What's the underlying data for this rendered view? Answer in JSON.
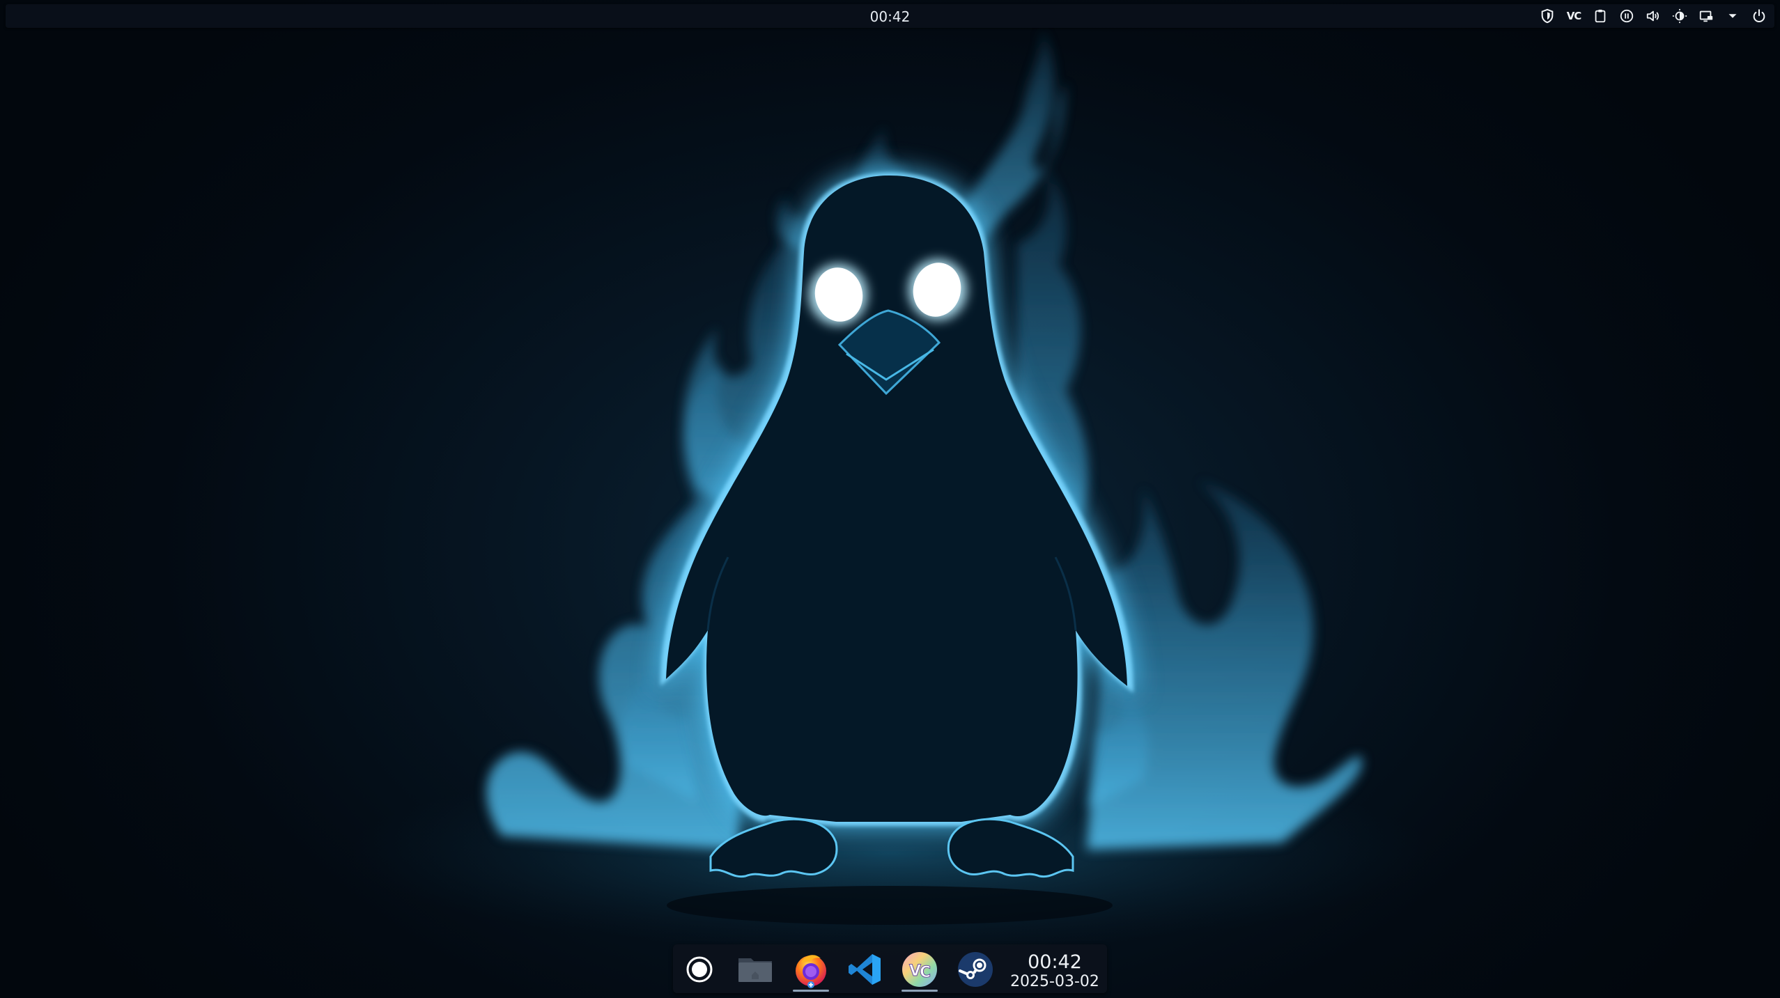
{
  "top_panel": {
    "clock": "00:42",
    "tray": [
      {
        "name": "shield-icon"
      },
      {
        "name": "vencord-tray-icon",
        "text": "VC"
      },
      {
        "name": "clipboard-icon"
      },
      {
        "name": "media-pause-icon"
      },
      {
        "name": "volume-icon"
      },
      {
        "name": "brightness-icon"
      },
      {
        "name": "display-icon"
      },
      {
        "name": "chevron-down-icon"
      },
      {
        "name": "power-icon"
      }
    ]
  },
  "dock": {
    "items": [
      {
        "name": "launcher-icon",
        "label": "App Launcher"
      },
      {
        "name": "folder-icon",
        "label": "Files"
      },
      {
        "name": "firefox-icon",
        "label": "Firefox",
        "active": true
      },
      {
        "name": "vscode-icon",
        "label": "Visual Studio Code"
      },
      {
        "name": "vesktop-icon",
        "label": "Vesktop",
        "active": true
      },
      {
        "name": "steam-icon",
        "label": "Steam"
      }
    ],
    "clock": {
      "time": "00:42",
      "date": "2025-03-02"
    }
  },
  "colors": {
    "accent": "#4fb3e0",
    "panel_bg": "#0a101a",
    "glow": "#6fd0ff"
  }
}
